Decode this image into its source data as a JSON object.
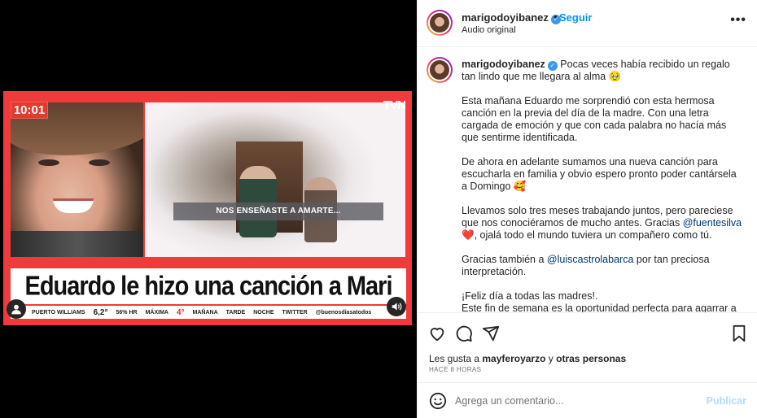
{
  "video": {
    "clock": "10:01",
    "channel_logo": "TVN",
    "subtitle": "NOS ENSEÑASTE A AMARTE...",
    "headline": "Eduardo le hizo una canción a Mari",
    "ticker": {
      "location": "PUERTO WILLIAMS",
      "temp": "6,2°",
      "humidity": "56% HR",
      "max_label": "MÁXIMA",
      "max_value": "4°",
      "tomorrow": "MAÑANA",
      "afternoon": "TARDE",
      "night": "NOCHE",
      "twitter": "TWITTER",
      "handle": "@buenosdiasatodos"
    }
  },
  "header": {
    "username": "marigodoyibanez",
    "separator": "•",
    "follow_label": "Seguir",
    "audio_label": "Audio original",
    "more_label": "•••"
  },
  "caption": {
    "username": "marigodoyibanez",
    "line1": "Pocas veces había recibido un regalo tan lindo que me llegara al alma 🥹",
    "p2": "Esta mañana Eduardo me sorprendió con esta hermosa canción en la previa del día de la madre. Con una letra cargada de emoción y que con cada palabra no hacía más que sentirme identificada.",
    "p3": "De ahora en adelante sumamos una nueva canción para escucharla en familia y obvio espero pronto poder cantársela a Domingo 🥰",
    "p4_pre": "Llevamos solo tres meses trabajando juntos, pero pareciese que nos conociéramos de mucho antes. Gracias",
    "p4_mention": "@fuentesilva",
    "p4_heart": "❤️",
    "p4_post": ", ojalá todo el mundo tuviera un compañero como tú.",
    "p5_pre": "Gracias también a",
    "p5_mention": "@luiscastrolabarca",
    "p5_post": "por tan preciosa interpretación.",
    "p6": "¡Feliz día a todas las madres!.",
    "p7": "Este fin de semana es la oportunidad perfecta para agarrar a tú"
  },
  "likes": {
    "prefix": "Les gusta a",
    "user": "mayferoyarzo",
    "joiner": "y",
    "others": "otras personas"
  },
  "timestamp": "HACE 8 HORAS",
  "comment": {
    "placeholder": "Agrega un comentario...",
    "publish_label": "Publicar"
  },
  "colors": {
    "accent": "#0095f6",
    "publish_disabled": "#b3dbff",
    "tv_red": "#ef3b3b",
    "verified": "#3897f0"
  },
  "icons": [
    "user-icon",
    "sound-icon",
    "heart-icon",
    "comment-icon",
    "share-icon",
    "bookmark-icon",
    "emoji-icon",
    "verified-icon",
    "more-icon"
  ]
}
